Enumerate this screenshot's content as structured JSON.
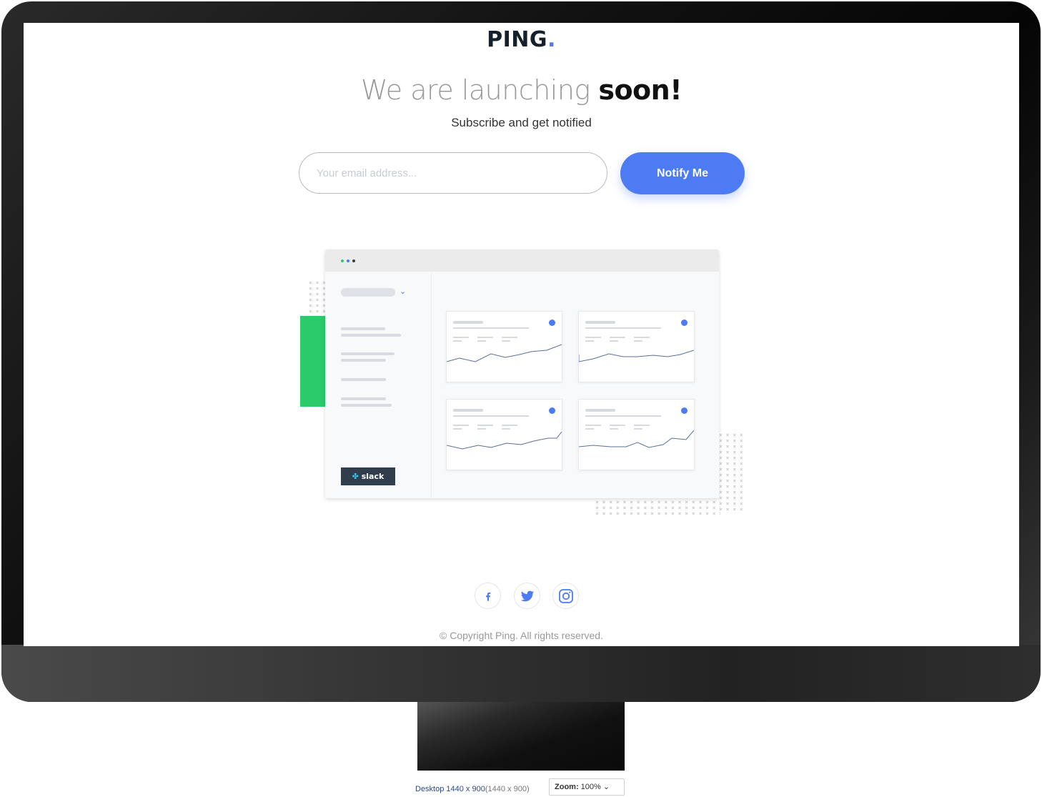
{
  "brand": {
    "name": "PING",
    "dot": ".",
    "accent_color": "#4c7bf3"
  },
  "hero": {
    "headline_light": "We are launching",
    "headline_bold": "soon!",
    "subtitle": "Subscribe and get notified"
  },
  "form": {
    "email_placeholder": "Your email address...",
    "email_value": "",
    "submit_label": "Notify Me"
  },
  "illustration": {
    "slack_label": "slack",
    "window_dot_colors": [
      "#2bcb6c",
      "#4c7bf3",
      "#2f3d4c"
    ],
    "accent_bar_color": "#2bcb6c"
  },
  "social": {
    "items": [
      {
        "name": "facebook",
        "icon": "facebook-icon"
      },
      {
        "name": "twitter",
        "icon": "twitter-icon"
      },
      {
        "name": "instagram",
        "icon": "instagram-icon"
      }
    ]
  },
  "footer": {
    "copyright": "© Copyright Ping. All rights reserved."
  },
  "viewport_bar": {
    "device": "Desktop 1440 x 900",
    "resolution": "(1440 x 900)",
    "zoom_label": "Zoom:",
    "zoom_value": "100%"
  }
}
